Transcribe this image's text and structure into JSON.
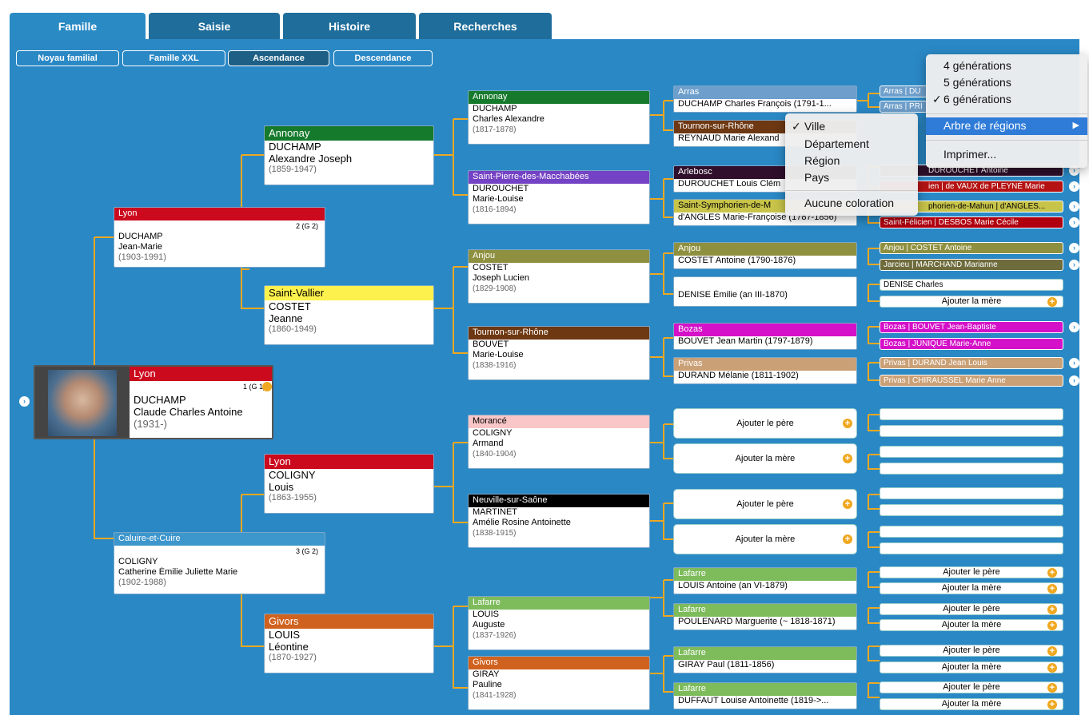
{
  "tabs": {
    "famille": "Famille",
    "saisie": "Saisie",
    "histoire": "Histoire",
    "recherches": "Recherches"
  },
  "subnav": {
    "noyau": "Noyau familial",
    "xxl": "Famille XXL",
    "ascendance": "Ascendance",
    "descendance": "Descendance"
  },
  "colors": {
    "lyon": "#cc0a1e",
    "annonay": "#167a2c",
    "saintvallier": "#fdf24d",
    "caluire": "#3d96cc",
    "givors": "#d0621f",
    "smacchabees": "#7442c4",
    "anjou": "#8f903f",
    "tournon": "#6e3812",
    "morance": "#f9c6c8",
    "neuville": "#000000",
    "lafarre": "#7dbb5b",
    "arras": "#6e9fcc",
    "arlebosc": "#2f0f2c",
    "ssymphorien": "#c8c44a",
    "bozas": "#d410c8",
    "privas": "#caa077",
    "jarcieu": "#6e6b3c",
    "stfelicien": "#b0000f",
    "vaux": "#b51313"
  },
  "root": {
    "place": "Lyon",
    "gen": "1 (G 1)",
    "surname": "DUCHAMP",
    "given": "Claude Charles Antoine",
    "dates": "(1931-)",
    "user_icon": "user-icon",
    "photo": "portrait-photo",
    "back_icon": "chevron-left-icon"
  },
  "g2": {
    "father": {
      "place": "Lyon",
      "gen": "2 (G 2)",
      "surname": "DUCHAMP",
      "given": "Jean-Marie",
      "dates": "(1903-1991)"
    },
    "mother": {
      "place": "Caluire-et-Cuire",
      "gen": "3 (G 2)",
      "surname": "COLIGNY",
      "given": "Catherine Émilie Juliette Marie",
      "dates": "(1902-1988)"
    }
  },
  "g3": [
    {
      "place": "Annonay",
      "surname": "DUCHAMP",
      "given": "Alexandre Joseph",
      "dates": "(1859-1947)"
    },
    {
      "place": "Saint-Vallier",
      "surname": "COSTET",
      "given": "Jeanne",
      "dates": "(1860-1949)"
    },
    {
      "place": "Lyon",
      "surname": "COLIGNY",
      "given": "Louis",
      "dates": "(1863-1955)"
    },
    {
      "place": "Givors",
      "surname": "LOUIS",
      "given": "Léontine",
      "dates": "(1870-1927)"
    }
  ],
  "g4": [
    {
      "place": "Annonay",
      "surname": "DUCHAMP",
      "given": "Charles Alexandre",
      "dates": "(1817-1878)"
    },
    {
      "place": "Saint-Pierre-des-Macchabées",
      "surname": "DUROUCHET",
      "given": "Marie-Louise",
      "dates": "(1816-1894)"
    },
    {
      "place": "Anjou",
      "surname": "COSTET",
      "given": "Joseph Lucien",
      "dates": "(1829-1908)"
    },
    {
      "place": "Tournon-sur-Rhône",
      "surname": "BOUVET",
      "given": "Marie-Louise",
      "dates": "(1838-1916)"
    },
    {
      "place": "Morancé",
      "surname": "COLIGNY",
      "given": "Armand",
      "dates": "(1840-1904)"
    },
    {
      "place": "Neuville-sur-Saône",
      "surname": "MARTINET",
      "given": "Amélie Rosine Antoinette",
      "dates": "(1838-1915)"
    },
    {
      "place": "Lafarre",
      "surname": "LOUIS",
      "given": "Auguste",
      "dates": "(1837-1926)"
    },
    {
      "place": "Givors",
      "surname": "GIRAY",
      "given": "Pauline",
      "dates": "(1841-1928)"
    }
  ],
  "g5": [
    {
      "place": "Arras",
      "text": "DUCHAMP Charles François (1791-1..."
    },
    {
      "place": "Tournon-sur-Rhône",
      "text": "REYNAUD Marie Alexand"
    },
    {
      "place": "Arlebosc",
      "text": "DUROUCHET Louis Clém"
    },
    {
      "place": "Saint-Symphorien-de-M",
      "text": "d'ANGLES Marie-Françoise (1787-1856)"
    },
    {
      "place": "Anjou",
      "text": "COSTET Antoine (1790-1876)"
    },
    {
      "place": "",
      "text": "DENISE Émilie (an III-1870)"
    },
    {
      "place": "Bozas",
      "text": "BOUVET Jean Martin (1797-1879)"
    },
    {
      "place": "Privas",
      "text": "DURAND Mélanie (1811-1902)"
    },
    {
      "place": "Lafarre",
      "text": "LOUIS Antoine (an VI-1879)"
    },
    {
      "place": "Lafarre",
      "text": "POULENARD Marguerite (~ 1818-1871)"
    },
    {
      "place": "Lafarre",
      "text": "GIRAY Paul (1811-1856)"
    },
    {
      "place": "Lafarre",
      "text": "DUFFAUT Louise Antoinette (1819->..."
    }
  ],
  "add_father": "Ajouter le père",
  "add_mother": "Ajouter la mère",
  "g6": {
    "arras1": "Arras | DU",
    "arras2": "Arras | PRI",
    "durouchet": "DUROUCHET Antoine",
    "vaux": "ien | de VAUX de PLEYNÉ Marie",
    "mahun": "phorien-de-Mahun | d'ANGLES...",
    "stfelicien": "Saint-Félicien | DESBOS Marie Cécile",
    "anjou": "Anjou | COSTET Antoine",
    "jarcieu": "Jarcieu | MARCHAND Marianne",
    "denise": "DENISE Charles",
    "bozas1": "Bozas | BOUVET Jean-Baptiste",
    "bozas2": "Bozas | JUNIQUE Marie-Anne",
    "privas1": "Privas | DURAND Jean Louis",
    "privas2": "Privas | CHIRAUSSEL Marie Anne"
  },
  "menu_main": {
    "g4": "4 générations",
    "g5": "5 générations",
    "g6": "6 générations",
    "checked": "✓",
    "regions": "Arbre de régions",
    "submenu_arrow": "▶",
    "print": "Imprimer..."
  },
  "menu_sub": {
    "ville": "Ville",
    "departement": "Département",
    "region": "Région",
    "pays": "Pays",
    "none": "Aucune coloration",
    "checked": "✓"
  },
  "plus_glyph": "+",
  "arrow_glyph": "›"
}
